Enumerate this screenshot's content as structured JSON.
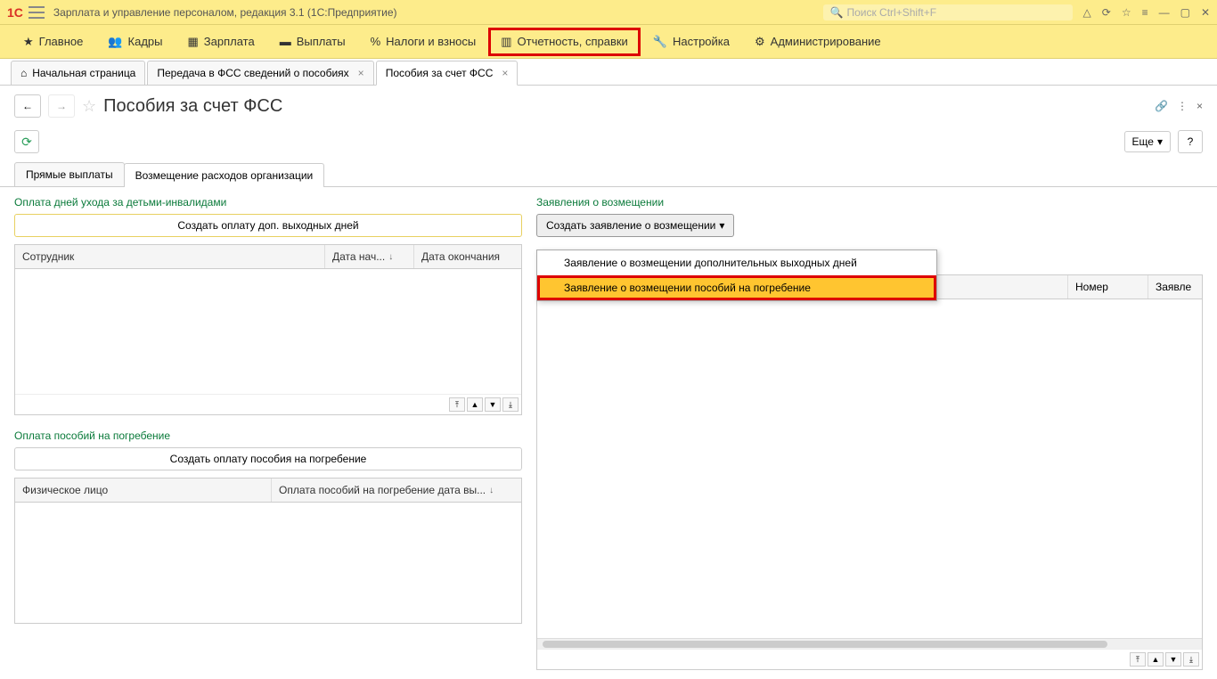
{
  "titlebar": {
    "app_title": "Зарплата и управление персоналом, редакция 3.1  (1С:Предприятие)",
    "search_placeholder": "Поиск Ctrl+Shift+F"
  },
  "mainmenu": {
    "items": [
      {
        "label": "Главное"
      },
      {
        "label": "Кадры"
      },
      {
        "label": "Зарплата"
      },
      {
        "label": "Выплаты"
      },
      {
        "label": "Налоги и взносы"
      },
      {
        "label": "Отчетность, справки"
      },
      {
        "label": "Настройка"
      },
      {
        "label": "Администрирование"
      }
    ]
  },
  "tabs": [
    {
      "label": "Начальная страница"
    },
    {
      "label": "Передача в ФСС сведений о пособиях"
    },
    {
      "label": "Пособия за счет ФСС"
    }
  ],
  "page": {
    "title": "Пособия за счет ФСС",
    "more_label": "Еще"
  },
  "subtabs": [
    {
      "label": "Прямые выплаты"
    },
    {
      "label": "Возмещение расходов организации"
    }
  ],
  "left": {
    "section1_title": "Оплата дней ухода за детьми-инвалидами",
    "section1_button": "Создать оплату доп. выходных дней",
    "grid1_cols": [
      "Сотрудник",
      "Дата нач...",
      "Дата окончания"
    ],
    "section2_title": "Оплата пособий на погребение",
    "section2_button": "Создать оплату пособия на погребение",
    "grid2_cols": [
      "Физическое лицо",
      "Оплата пособий на погребение дата вы..."
    ]
  },
  "right": {
    "section_title": "Заявления о возмещении",
    "dropdown_label": "Создать заявление о возмещении",
    "dropdown_items": [
      "Заявление о возмещении дополнительных выходных дней",
      "Заявление о возмещении пособий на погребение"
    ],
    "grid_cols": [
      "",
      "Номер",
      "Заявле"
    ]
  }
}
